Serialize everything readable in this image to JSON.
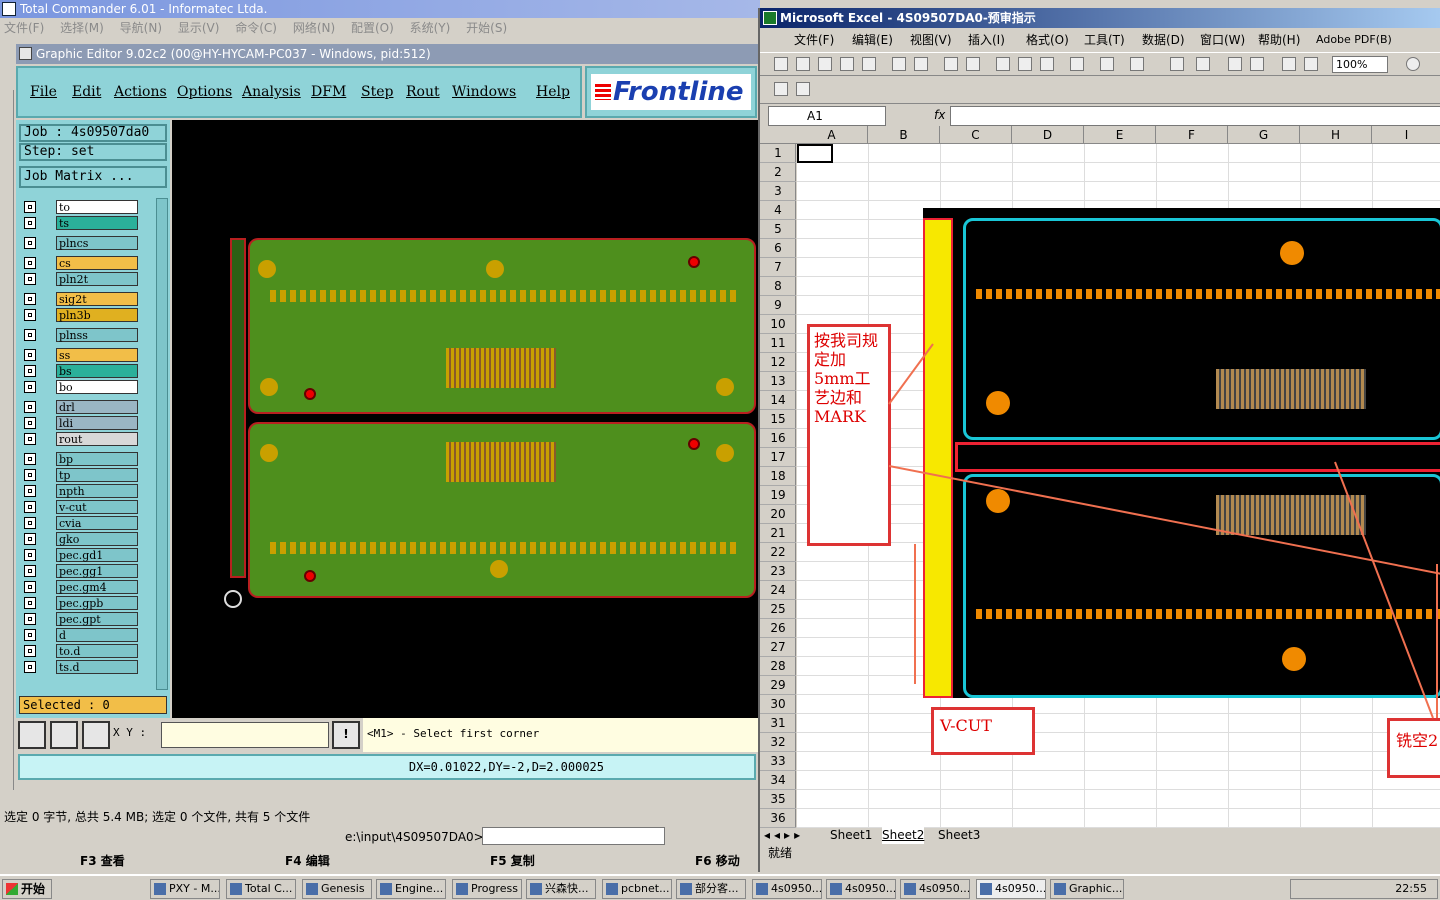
{
  "tc": {
    "title": "Total Commander 6.01 - Informatec Ltda.",
    "menu": [
      "文件(F)",
      "选择(M)",
      "导航(N)",
      "显示(V)",
      "命令(C)",
      "网络(N)",
      "配置(O)",
      "系统(Y)",
      "开始(S)"
    ],
    "status": "选定 0 字节, 总共 5.4 MB; 选定 0 个文件, 共有 5 个文件",
    "path": "e:\\input\\4S09507DA0>",
    "fkeys": [
      "F3 查看",
      "F4 编辑",
      "F5 复制",
      "F6 移动"
    ]
  },
  "ge": {
    "title": "Graphic Editor 9.02c2 (00@HY-HYCAM-PC037 - Windows, pid:512)",
    "menu": [
      "File",
      "Edit",
      "Actions",
      "Options",
      "Analysis",
      "DFM",
      "Step",
      "Rout",
      "Windows",
      "Help"
    ],
    "logo": "Frontline",
    "job": "Job : 4s09507da0",
    "step": "Step: set",
    "matrix_button": "Job Matrix ...",
    "layers": [
      {
        "name": "to",
        "color": "#ffffff"
      },
      {
        "name": "ts",
        "color": "#2bb09a"
      },
      {
        "name": "plncs",
        "color": "#7ec5ca"
      },
      {
        "name": "cs",
        "color": "#f2be48"
      },
      {
        "name": "pln2t",
        "color": "#7ec5ca"
      },
      {
        "name": "sig2t",
        "color": "#f2be48"
      },
      {
        "name": "pln3b",
        "color": "#e0b020"
      },
      {
        "name": "plnss",
        "color": "#7ec5ca"
      },
      {
        "name": "ss",
        "color": "#f2be48"
      },
      {
        "name": "bs",
        "color": "#2bb09a"
      },
      {
        "name": "bo",
        "color": "#ffffff"
      },
      {
        "name": "drl",
        "color": "#9ab6c4"
      },
      {
        "name": "ldi",
        "color": "#9ab6c4"
      },
      {
        "name": "rout",
        "color": "#d8d8d8"
      },
      {
        "name": "bp",
        "color": "#7ec5ca"
      },
      {
        "name": "tp",
        "color": "#7ec5ca"
      },
      {
        "name": "npth",
        "color": "#7ec5ca"
      },
      {
        "name": "v-cut",
        "color": "#7ec5ca"
      },
      {
        "name": "cvia",
        "color": "#7ec5ca"
      },
      {
        "name": "gko",
        "color": "#7ec5ca"
      },
      {
        "name": "pec.gd1",
        "color": "#7ec5ca"
      },
      {
        "name": "pec.gg1",
        "color": "#7ec5ca"
      },
      {
        "name": "pec.gm4",
        "color": "#7ec5ca"
      },
      {
        "name": "pec.gpb",
        "color": "#7ec5ca"
      },
      {
        "name": "pec.gpt",
        "color": "#7ec5ca"
      },
      {
        "name": "d",
        "color": "#7ec5ca"
      },
      {
        "name": "to.d",
        "color": "#7ec5ca"
      },
      {
        "name": "ts.d",
        "color": "#7ec5ca"
      }
    ],
    "selected": "Selected : 0",
    "xy_label": "X Y :",
    "prompt": "<M1> - Select first corner",
    "measure": "DX=0.01022,DY=-2,D=2.000025"
  },
  "xl": {
    "title": "Microsoft Excel - 4S09507DA0-预审指示",
    "menu": [
      "文件(F)",
      "编辑(E)",
      "视图(V)",
      "插入(I)",
      "格式(O)",
      "工具(T)",
      "数据(D)",
      "窗口(W)",
      "帮助(H)",
      "Adobe PDF(B)"
    ],
    "zoom": "100%",
    "namebox": "A1",
    "fx": "fx",
    "columns": [
      "A",
      "B",
      "C",
      "D",
      "E",
      "F",
      "G",
      "H",
      "I"
    ],
    "rows": [
      "1",
      "2",
      "3",
      "4",
      "5",
      "6",
      "7",
      "8",
      "9",
      "10",
      "11",
      "12",
      "13",
      "14",
      "15",
      "16",
      "17",
      "18",
      "19",
      "20",
      "21",
      "22",
      "23",
      "24",
      "25",
      "26",
      "27",
      "28",
      "29",
      "30",
      "31",
      "32",
      "33",
      "34",
      "35",
      "36"
    ],
    "callout_margin": "按我司规定加5mm工艺边和MARK",
    "callout_vcut": "V-CUT",
    "callout_mill": "铣空2",
    "tabs": [
      "Sheet1",
      "Sheet2",
      "Sheet3"
    ],
    "status": "就绪"
  },
  "taskbar": {
    "start": "开始",
    "tasks": [
      "PXY - M...",
      "Total C...",
      "Genesis",
      "Engine...",
      "Progress",
      "兴森快...",
      "pcbnet...",
      "部分客...",
      "4s0950...",
      "4s0950...",
      "4s0950...",
      "4s0950...",
      "Graphic..."
    ],
    "clock": "22:55"
  }
}
